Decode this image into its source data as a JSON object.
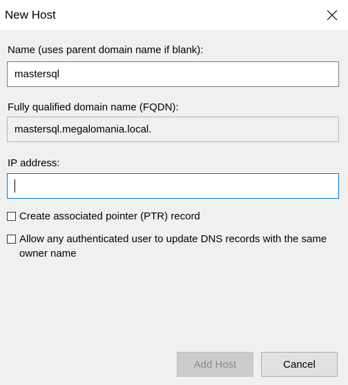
{
  "window": {
    "title": "New Host"
  },
  "form": {
    "name_label": "Name (uses parent domain name if blank):",
    "name_value": "mastersql",
    "fqdn_label": "Fully qualified domain name (FQDN):",
    "fqdn_value": "mastersql.megalomania.local.",
    "ip_label": "IP address:",
    "ip_value": ""
  },
  "options": {
    "ptr_label": "Create associated pointer (PTR) record",
    "ptr_checked": false,
    "allow_update_label": "Allow any authenticated user to update DNS records with the same owner name",
    "allow_update_checked": false
  },
  "buttons": {
    "add_host": "Add Host",
    "add_host_enabled": false,
    "cancel": "Cancel"
  },
  "icons": {
    "close": "close-icon"
  }
}
